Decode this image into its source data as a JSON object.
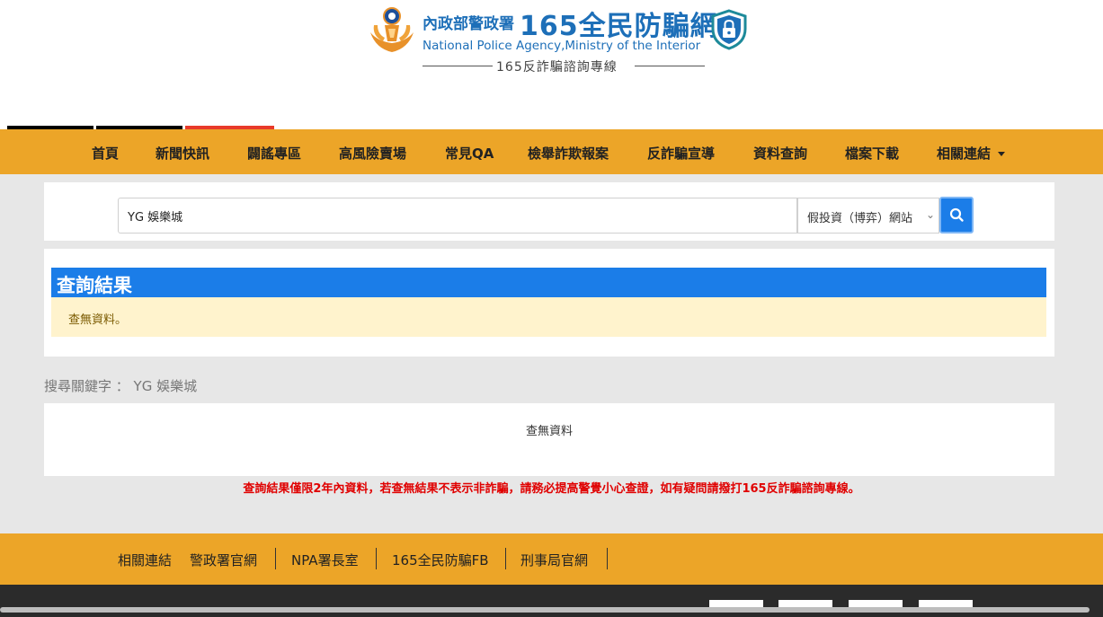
{
  "header": {
    "agency_zh": "內政部警政署",
    "site_name": "165全民防騙網",
    "agency_en": "National Police Agency,Ministry of the Interior",
    "hotline": "165反詐騙諮詢專線"
  },
  "nav": {
    "items": [
      "首頁",
      "新聞快訊",
      "闢謠專區",
      "高風險賣場",
      "常見QA",
      "檢舉詐欺報案",
      "反詐騙宣導",
      "資料查詢",
      "檔案下載",
      "相關連結"
    ]
  },
  "search": {
    "query": "YG 娛樂城",
    "category": "假投資（博弈）網站"
  },
  "result": {
    "heading": "查詢結果",
    "alert": "查無資料。"
  },
  "keyword_line": "搜尋關鍵字 ： YG 娛樂城",
  "empty_text": "查無資料",
  "disclaimer": "查詢結果僅限2年內資料，若查無結果不表示非詐騙，請務必提高警覺小心查證，如有疑問請撥打165反詐騙諮詢專線。",
  "footer": {
    "label": "相關連結",
    "links": [
      "警政署官網",
      "NPA署長室",
      "165全民防騙FB",
      "刑事局官網"
    ]
  },
  "colors": {
    "nav_bg": "#eca528",
    "primary": "#1b7de8",
    "alert_bg": "#fff3cd",
    "warning_text": "#e00000"
  }
}
